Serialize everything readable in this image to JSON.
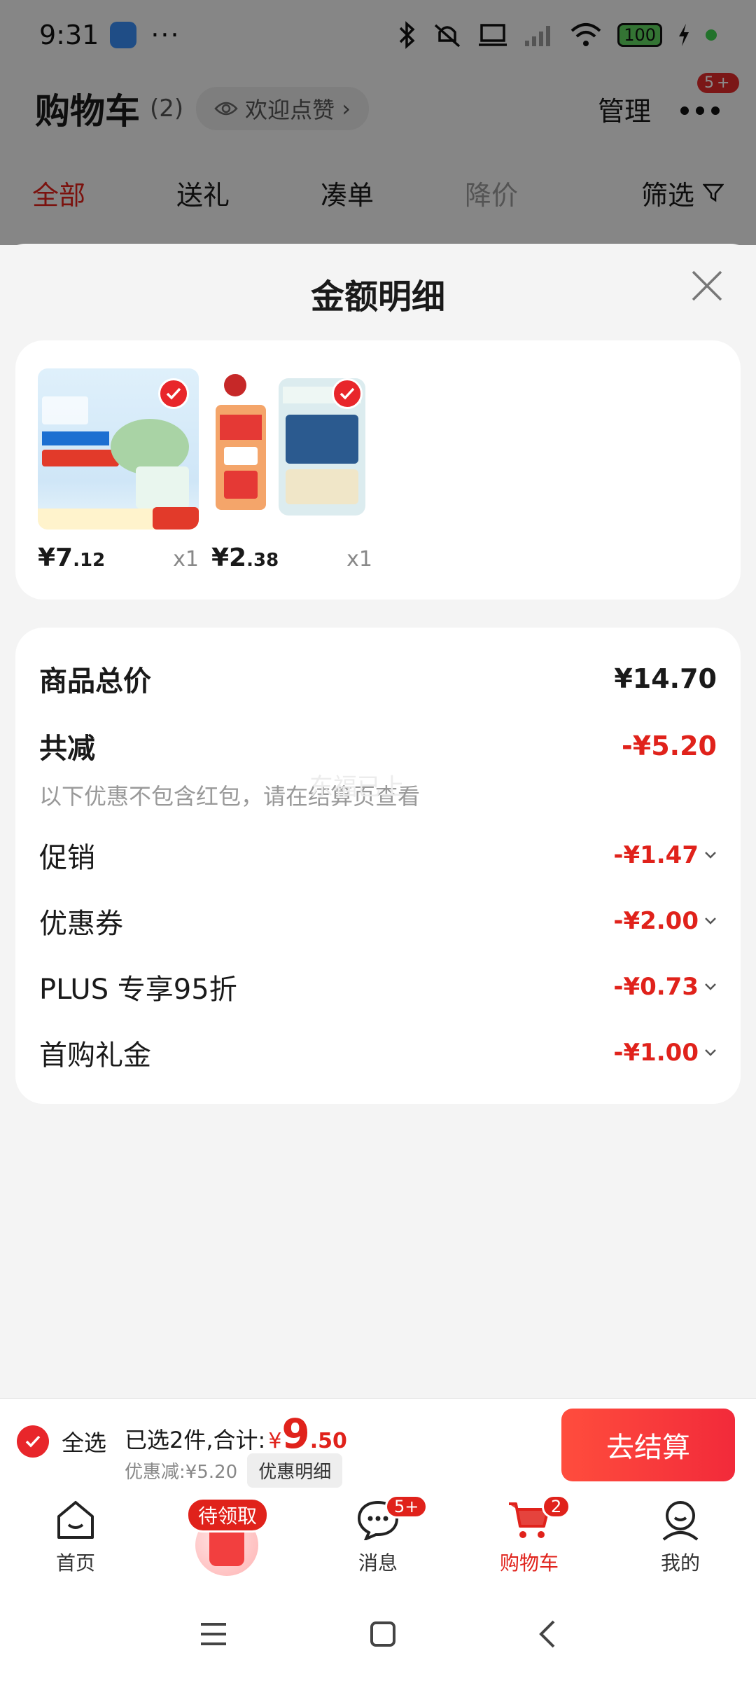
{
  "status_bar": {
    "time": "9:31",
    "more": "···",
    "battery": "100"
  },
  "cart_header": {
    "title": "购物车",
    "count": "(2)",
    "like_label": "欢迎点赞",
    "like_chevron": "›",
    "manage_label": "管理",
    "more_badge": "5+"
  },
  "cart_tabs": [
    {
      "label": "全部"
    },
    {
      "label": "送礼"
    },
    {
      "label": "凑单"
    },
    {
      "label": "降价"
    }
  ],
  "filter_label": "筛选",
  "sheet": {
    "title": "金额明细",
    "products": [
      {
        "price_int": "¥7",
        "price_cent": ".12",
        "qty": "x1"
      },
      {
        "price_int": "¥2",
        "price_cent": ".38",
        "qty": "x1"
      }
    ],
    "summary": {
      "total_label": "商品总价",
      "total_value": "¥14.70",
      "reduction_label": "共减",
      "reduction_value": "-¥5.20",
      "hint": "以下优惠不包含红包，请在结算页查看",
      "watermark": "东福已上"
    },
    "discounts": [
      {
        "label": "促销",
        "value": "-¥1.47"
      },
      {
        "label": "优惠券",
        "value": "-¥2.00"
      },
      {
        "label": "PLUS 专享95折",
        "value": "-¥0.73"
      },
      {
        "label": "首购礼金",
        "value": "-¥1.00"
      }
    ]
  },
  "checkout": {
    "select_all": "全选",
    "selected_text": "已选2件,合计:",
    "currency": "¥",
    "total_int": "9",
    "total_dec": ".50",
    "discount_text": "优惠减:¥5.20",
    "discount_detail_button": "优惠明细",
    "checkout_button": "去结算"
  },
  "tabbar": {
    "home": "首页",
    "promo_tag": "待领取",
    "messages": "消息",
    "messages_badge": "5+",
    "cart": "购物车",
    "cart_badge": "2",
    "mine": "我的"
  },
  "colors": {
    "accent": "#e0221b",
    "button": "#f22a3a"
  }
}
